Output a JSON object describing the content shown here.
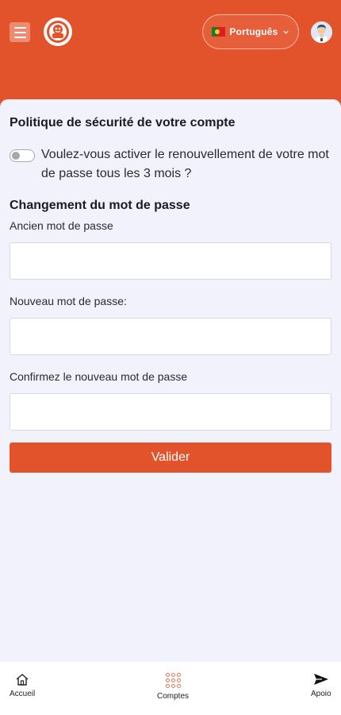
{
  "header": {
    "language_label": "Português",
    "menu_icon": "menu-icon",
    "logo_icon": "brand-logo",
    "flag_icon": "portugal-flag-icon",
    "avatar_icon": "user-avatar-icon",
    "brand_color": "#e2532b"
  },
  "security": {
    "title": "Politique de sécurité de votre compte",
    "toggle_label": "Voulez-vous activer le renouvellement de votre mot de passe tous les 3 mois ?",
    "toggle_on": false
  },
  "password_change": {
    "title": "Changement du mot de passe",
    "old_label": "Ancien mot de passe",
    "old_value": "",
    "new_label": "Nouveau mot de passe:",
    "new_value": "",
    "confirm_label": "Confirmez le nouveau mot de passe",
    "confirm_value": "",
    "submit_label": "Valider"
  },
  "bottom_nav": {
    "items": [
      {
        "label": "Accueil",
        "icon": "home-icon"
      },
      {
        "label": "Comptes",
        "icon": "grid-icon"
      },
      {
        "label": "Apoio",
        "icon": "send-icon"
      }
    ]
  }
}
